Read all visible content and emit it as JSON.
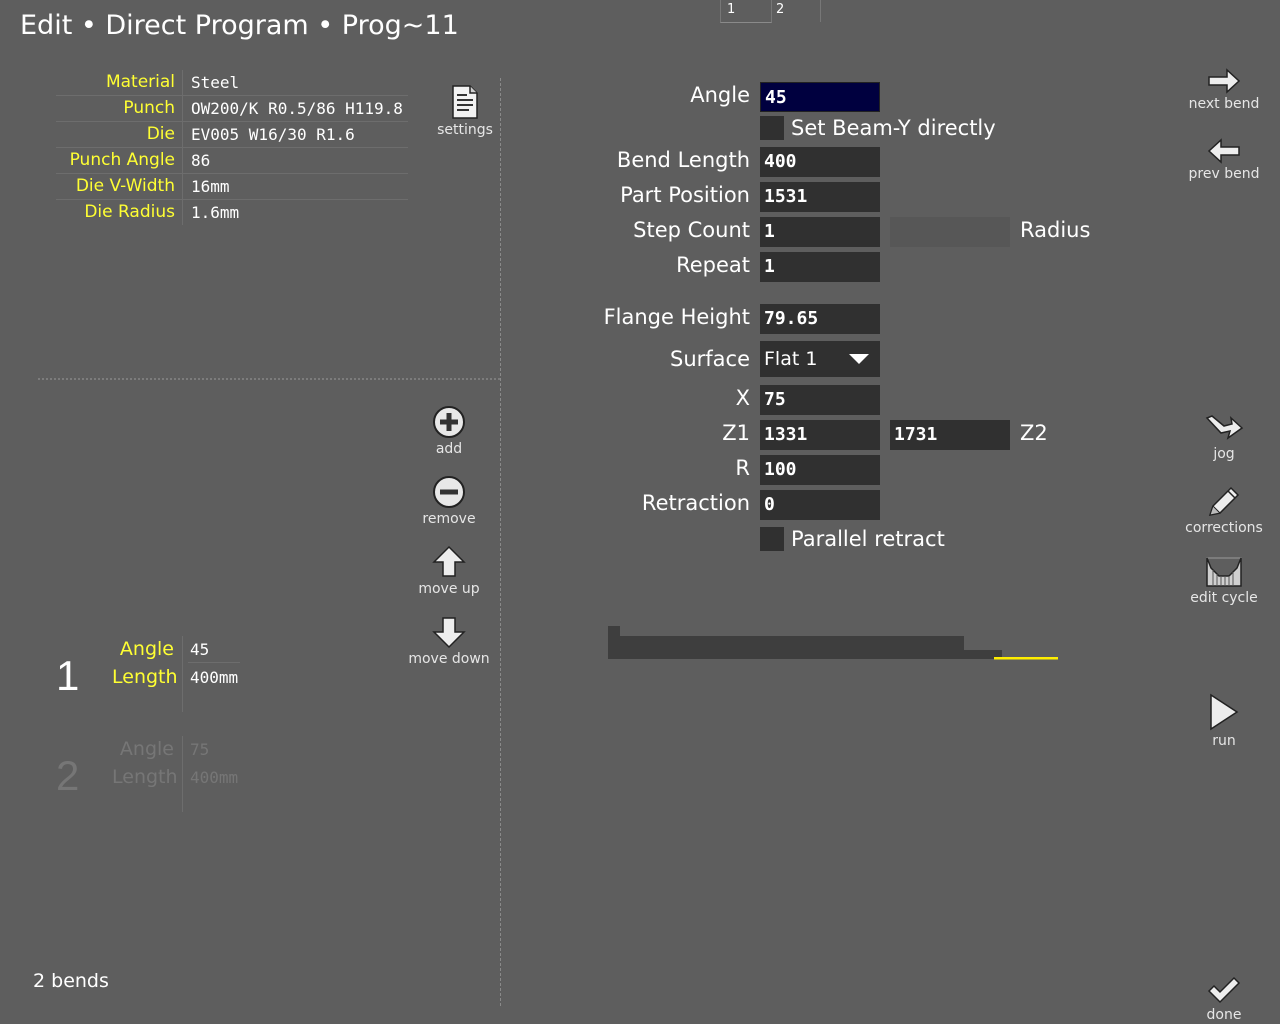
{
  "header": {
    "title": "Edit  •  Direct Program  •  Prog~11",
    "tabs": [
      "1",
      "2"
    ]
  },
  "tooling": {
    "rows": [
      {
        "label": "Material",
        "value": "Steel"
      },
      {
        "label": "Punch",
        "value": "OW200/K R0.5/86 H119.8"
      },
      {
        "label": "Die",
        "value": "EV005 W16/30 R1.6"
      },
      {
        "label": "Punch Angle",
        "value": "86"
      },
      {
        "label": "Die V-Width",
        "value": "16mm"
      },
      {
        "label": "Die Radius",
        "value": "1.6mm"
      }
    ],
    "settings_label": "settings"
  },
  "list_tools": {
    "add": "add",
    "remove": "remove",
    "move_up": "move up",
    "move_down": "move down"
  },
  "bends": [
    {
      "number": "1",
      "angle_label": "Angle",
      "angle": "45",
      "length_label": "Length",
      "length": "400mm",
      "selected": true
    },
    {
      "number": "2",
      "angle_label": "Angle",
      "angle": "75",
      "length_label": "Length",
      "length": "400mm",
      "selected": false
    }
  ],
  "bend_count": "2 bends",
  "form": {
    "angle_label": "Angle",
    "angle": "45",
    "beam_y_label": "Set Beam-Y directly",
    "bend_length_label": "Bend Length",
    "bend_length": "400",
    "part_position_label": "Part Position",
    "part_position": "1531",
    "step_count_label": "Step Count",
    "step_count": "1",
    "radius_label": "Radius",
    "radius": "",
    "repeat_label": "Repeat",
    "repeat": "1",
    "flange_height_label": "Flange Height",
    "flange_height": "79.65",
    "surface_label": "Surface",
    "surface": "Flat 1",
    "x_label": "X",
    "x": "75",
    "z1_label": "Z1",
    "z1": "1331",
    "z2_label": "Z2",
    "z2": "1731",
    "r_label": "R",
    "r": "100",
    "retraction_label": "Retraction",
    "retraction": "0",
    "parallel_retract_label": "Parallel retract"
  },
  "right_tools": {
    "next_bend": "next bend",
    "prev_bend": "prev bend",
    "jog": "jog",
    "corrections": "corrections",
    "edit_cycle": "edit cycle",
    "run": "run",
    "done": "done"
  },
  "colors": {
    "background": "#5e5e5e",
    "label_yellow": "#ffff33",
    "field_bg": "#303030",
    "active_field_bg": "#00003f",
    "preview_part": "#3e3e3e",
    "preview_line": "#ffee00"
  }
}
